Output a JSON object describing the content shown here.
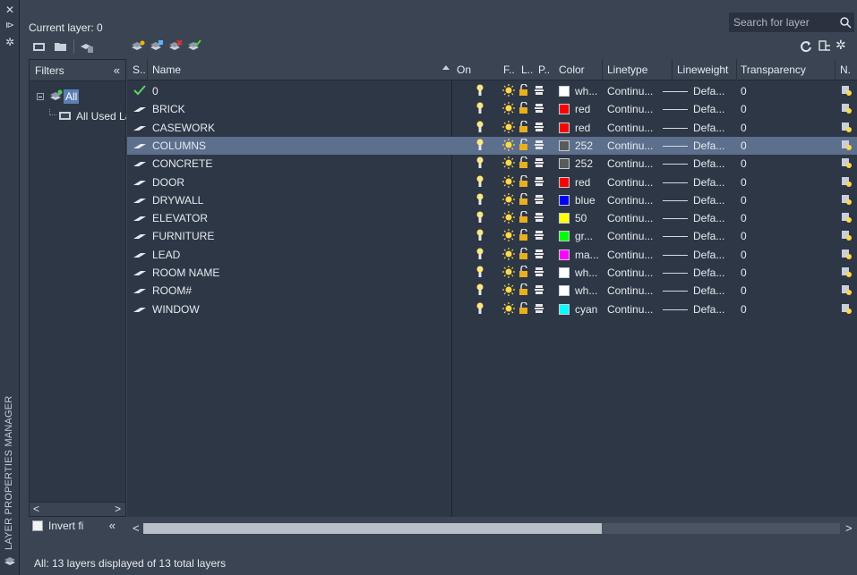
{
  "panel": {
    "vertical_title": "LAYER PROPERTIES MANAGER",
    "current_layer": "Current layer: 0",
    "search_placeholder": "Search for layer",
    "status_text": "All: 13 layers displayed of 13 total layers"
  },
  "filters": {
    "header": "Filters",
    "tree": [
      {
        "label": "All"
      },
      {
        "label": "All Used Layers"
      }
    ],
    "invert_label": "Invert fi"
  },
  "columns": [
    "S..",
    "Name",
    "On",
    "F..",
    "L..",
    "P..",
    "Color",
    "Linetype",
    "Lineweight",
    "Transparency",
    "N."
  ],
  "layers": [
    {
      "status": "current",
      "name": "0",
      "color_name": "wh...",
      "color_hex": "#ffffff",
      "linetype": "Continu...",
      "lineweight": "Defa...",
      "transparency": "0"
    },
    {
      "status": "layer",
      "name": "BRICK",
      "color_name": "red",
      "color_hex": "#ff0000",
      "linetype": "Continu...",
      "lineweight": "Defa...",
      "transparency": "0"
    },
    {
      "status": "layer",
      "name": "CASEWORK",
      "color_name": "red",
      "color_hex": "#ff0000",
      "linetype": "Continu...",
      "lineweight": "Defa...",
      "transparency": "0"
    },
    {
      "status": "layer",
      "name": "COLUMNS",
      "color_name": "252",
      "color_hex": "#5a5a5a",
      "linetype": "Continu...",
      "lineweight": "Defa...",
      "transparency": "0",
      "selected": true
    },
    {
      "status": "layer",
      "name": "CONCRETE",
      "color_name": "252",
      "color_hex": "#5a5a5a",
      "linetype": "Continu...",
      "lineweight": "Defa...",
      "transparency": "0"
    },
    {
      "status": "layer",
      "name": "DOOR",
      "color_name": "red",
      "color_hex": "#ff0000",
      "linetype": "Continu...",
      "lineweight": "Defa...",
      "transparency": "0"
    },
    {
      "status": "layer",
      "name": "DRYWALL",
      "color_name": "blue",
      "color_hex": "#0000ff",
      "linetype": "Continu...",
      "lineweight": "Defa...",
      "transparency": "0"
    },
    {
      "status": "layer",
      "name": "ELEVATOR",
      "color_name": "50",
      "color_hex": "#ffff00",
      "linetype": "Continu...",
      "lineweight": "Defa...",
      "transparency": "0"
    },
    {
      "status": "layer",
      "name": "FURNITURE",
      "color_name": "gr...",
      "color_hex": "#00ff00",
      "linetype": "Continu...",
      "lineweight": "Defa...",
      "transparency": "0"
    },
    {
      "status": "layer",
      "name": "LEAD",
      "color_name": "ma...",
      "color_hex": "#ff00ff",
      "linetype": "Continu...",
      "lineweight": "Defa...",
      "transparency": "0"
    },
    {
      "status": "layer",
      "name": "ROOM NAME",
      "color_name": "wh...",
      "color_hex": "#ffffff",
      "linetype": "Continu...",
      "lineweight": "Defa...",
      "transparency": "0"
    },
    {
      "status": "layer",
      "name": "ROOM#",
      "color_name": "wh...",
      "color_hex": "#ffffff",
      "linetype": "Continu...",
      "lineweight": "Defa...",
      "transparency": "0"
    },
    {
      "status": "layer",
      "name": "WINDOW",
      "color_name": "cyan",
      "color_hex": "#00ffff",
      "linetype": "Continu...",
      "lineweight": "Defa...",
      "transparency": "0"
    }
  ],
  "icons": {
    "strip": [
      "close-icon",
      "auto-hide-icon",
      "properties-icon"
    ],
    "toolbar_left": [
      "new-property-filter-icon",
      "new-group-filter-icon",
      "layer-states-manager-icon"
    ],
    "toolbar_layers": [
      "new-layer-icon",
      "new-layer-vp-frozen-icon",
      "delete-layer-icon",
      "set-current-icon"
    ],
    "toolbar_right": [
      "refresh-icon",
      "settings-icon",
      "gear-icon"
    ]
  }
}
